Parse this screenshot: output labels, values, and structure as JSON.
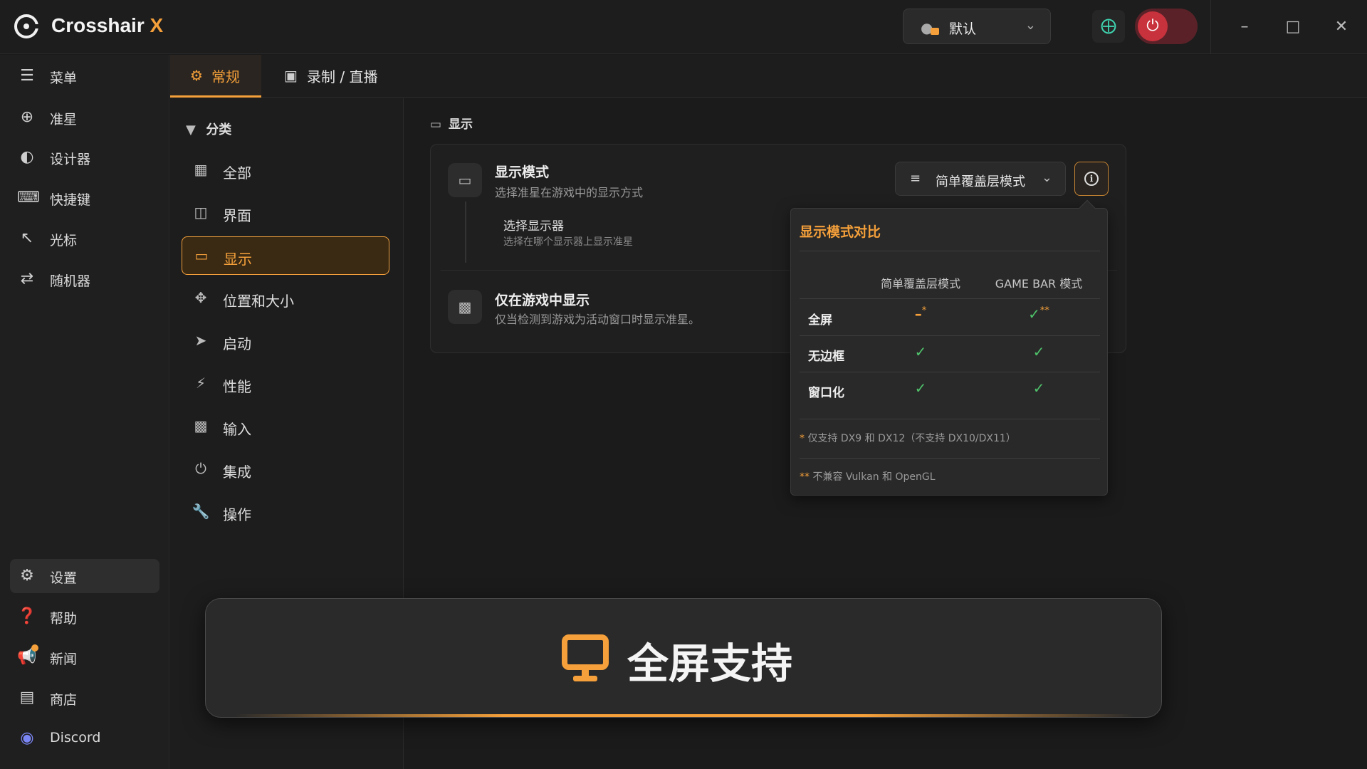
{
  "app": {
    "title": "Crosshair",
    "title_accent": "X"
  },
  "profile": {
    "label": "默认"
  },
  "nav": {
    "items": [
      {
        "label": "菜单",
        "icon": "menu-icon"
      },
      {
        "label": "准星",
        "icon": "crosshair-icon"
      },
      {
        "label": "设计器",
        "icon": "palette-icon"
      },
      {
        "label": "快捷键",
        "icon": "keyboard-icon"
      },
      {
        "label": "光标",
        "icon": "cursor-icon"
      },
      {
        "label": "随机器",
        "icon": "shuffle-icon"
      }
    ],
    "bottom": [
      {
        "label": "设置",
        "icon": "gear-icon",
        "active": true
      },
      {
        "label": "帮助",
        "icon": "help-icon"
      },
      {
        "label": "新闻",
        "icon": "megaphone-icon"
      },
      {
        "label": "商店",
        "icon": "store-icon"
      },
      {
        "label": "Discord",
        "icon": "discord-icon"
      }
    ]
  },
  "tabs": [
    {
      "label": "常规",
      "active": true
    },
    {
      "label": "录制 / 直播"
    }
  ],
  "categories": {
    "heading": "分类",
    "items": [
      {
        "label": "全部"
      },
      {
        "label": "界面"
      },
      {
        "label": "显示",
        "active": true
      },
      {
        "label": "位置和大小"
      },
      {
        "label": "启动"
      },
      {
        "label": "性能"
      },
      {
        "label": "输入"
      },
      {
        "label": "集成"
      },
      {
        "label": "操作"
      }
    ]
  },
  "section": {
    "title": "显示",
    "display_mode": {
      "title": "显示模式",
      "desc": "选择准星在游戏中的显示方式",
      "value": "简单覆盖层模式"
    },
    "select_monitor": {
      "title": "选择显示器",
      "desc": "选择在哪个显示器上显示准星"
    },
    "game_only": {
      "title": "仅在游戏中显示",
      "desc": "仅当检测到游戏为活动窗口时显示准星。"
    }
  },
  "popover": {
    "title": "显示模式对比",
    "col1": "简单覆盖层模式",
    "col2": "GAME BAR 模式",
    "rows": [
      {
        "label": "全屏",
        "c1": "–",
        "c1_star": "*",
        "c2": "✓",
        "c2_star": "**"
      },
      {
        "label": "无边框",
        "c1": "✓",
        "c2": "✓"
      },
      {
        "label": "窗口化",
        "c1": "✓",
        "c2": "✓"
      }
    ],
    "note1_star": "*",
    "note1": "仅支持 DX9 和 DX12（不支持 DX10/DX11）",
    "note2_star": "**",
    "note2": "不兼容 Vulkan 和 OpenGL"
  },
  "toast": {
    "text": "全屏支持"
  },
  "colors": {
    "accent": "#f5a03a",
    "check": "#4fc36b",
    "power": "#c8323d"
  }
}
